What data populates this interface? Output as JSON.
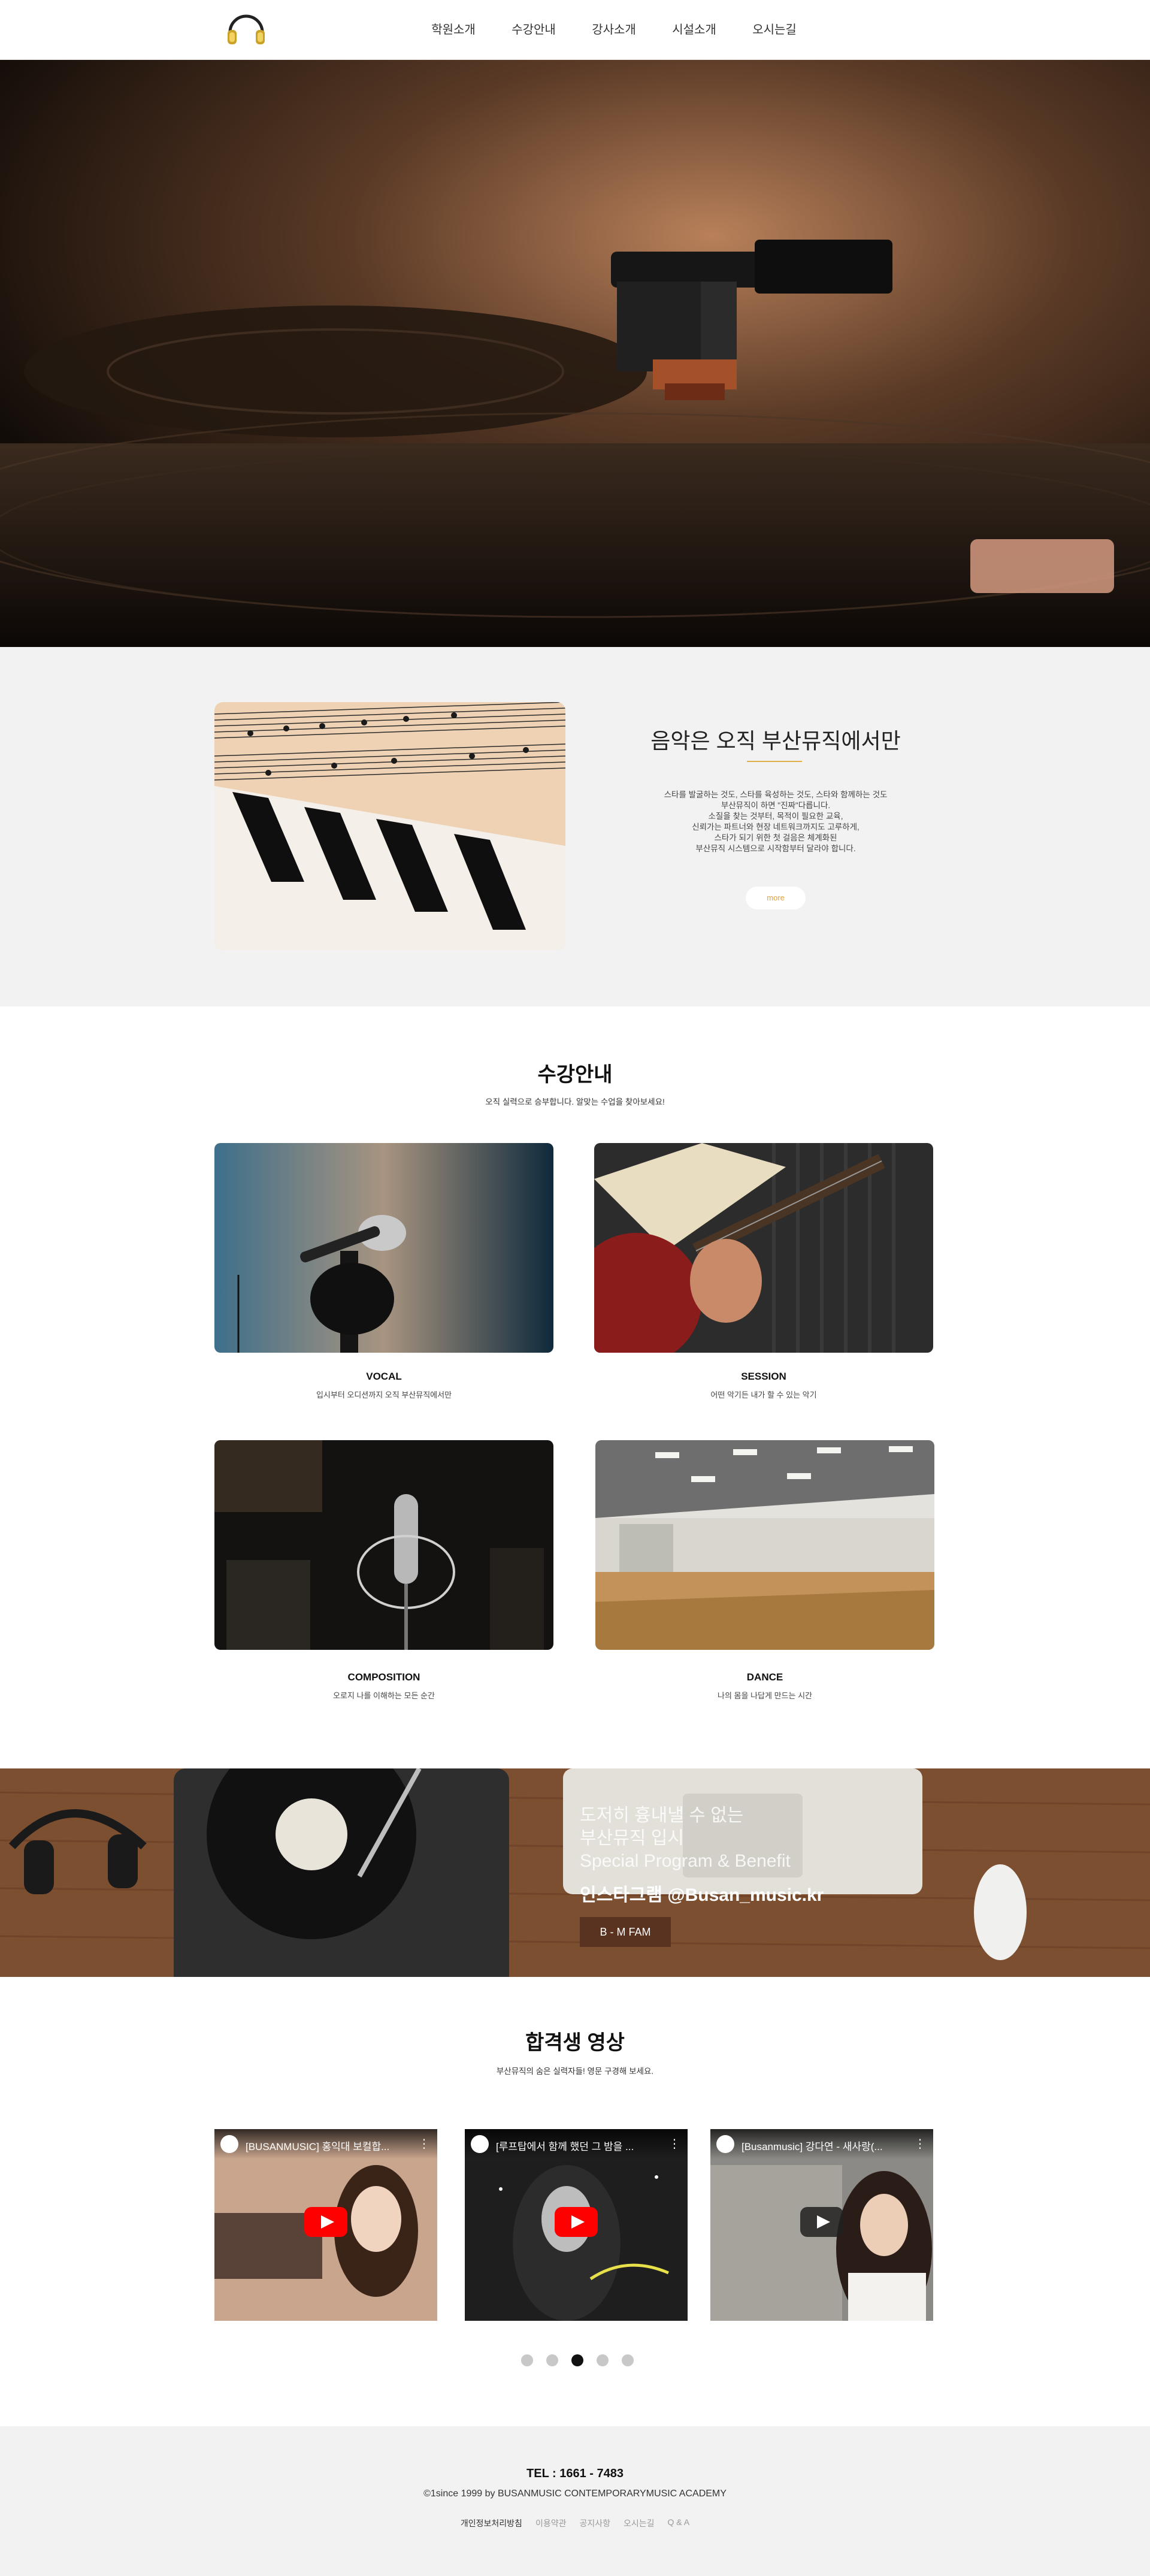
{
  "header": {
    "nav": [
      "학원소개",
      "수강안내",
      "강사소개",
      "시설소개",
      "오시는길"
    ]
  },
  "intro": {
    "title": "음악은 오직 부산뮤직에서만",
    "text": "스타를 발굴하는 것도, 스타를 육성하는 것도, 스타와 함께하는 것도\n부산뮤직이 하면 \"진짜\"다릅니다.\n소질을 찾는 것부터, 목적이 필요한 교육,\n신뢰가는 파트너와 현장 네트워크까지도 고루하게,\n스타가 되기 위한 첫 걸음은 체계화된\n부산뮤직 시스템으로 시작함부터 달라야 합니다.",
    "more": "more"
  },
  "courses": {
    "title": "수강안내",
    "subtitle": "오직 실력으로 승부합니다. 알맞는 수업을 찾아보세요!",
    "items": [
      {
        "name": "VOCAL",
        "desc": "입시부터 오디션까지 오직 부산뮤직에서만"
      },
      {
        "name": "SESSION",
        "desc": "어떤 악기든 내가 할 수 있는 악기"
      },
      {
        "name": "COMPOSITION",
        "desc": "오로지 나를 이해하는 모든 순간"
      },
      {
        "name": "DANCE",
        "desc": "나의 몸을 나답게 만드는 시간"
      }
    ]
  },
  "banner": {
    "text": "도저히 흉내낼 수 없는\n부산뮤직 입시\nSpecial Program & Benefit",
    "handle": "인스타그램 @Busan_music.kr",
    "button": "B - M FAM"
  },
  "videos": {
    "title": "합격생 영상",
    "subtitle": "부산뮤직의 숨은 실력자들! 영문 구경해 보세요.",
    "items": [
      {
        "title": "[BUSANMUSIC] 홍익대 보컬합..."
      },
      {
        "title": "[루프탑에서 함께 했던 그 밤을 ..."
      },
      {
        "title": "[Busanmusic] 강다연 - 새사랑(..."
      }
    ],
    "active_dot": 3
  },
  "footer": {
    "tel": "TEL : 1661 - 7483",
    "copyright": "©1since 1999 by BUSANMUSIC CONTEMPORARYMUSIC ACADEMY",
    "links": [
      "개인정보처리방침",
      "이용약관",
      "공지사항",
      "오시는길",
      "Q & A"
    ]
  },
  "colors": {
    "accent": "#e1b04a",
    "banner_button": "#5a3220",
    "youtube_red": "#ff0000"
  }
}
